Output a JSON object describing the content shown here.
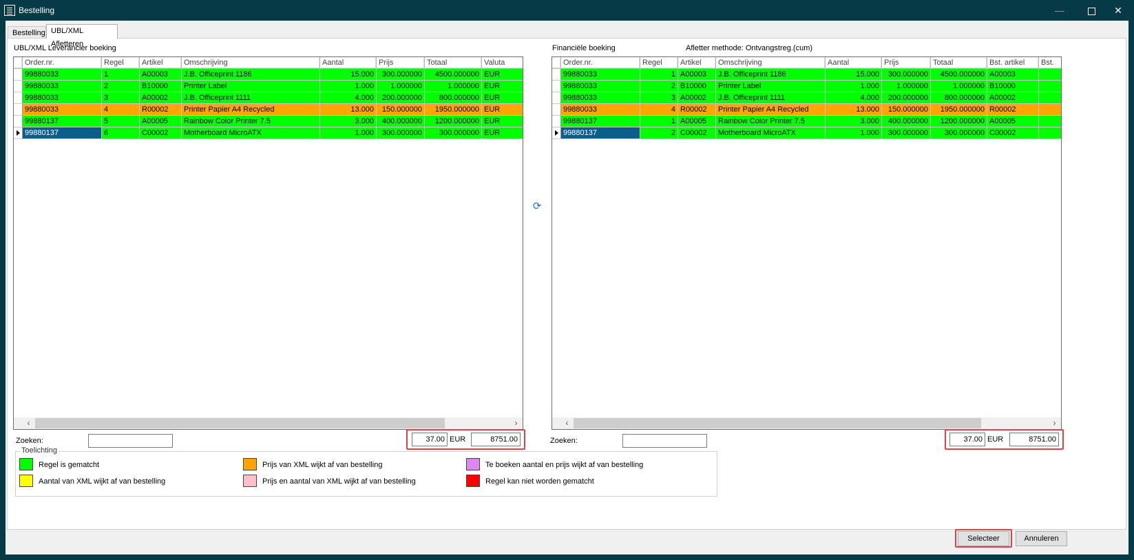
{
  "window": {
    "title": "Bestelling",
    "min_glyph": "—",
    "close_glyph": "✕"
  },
  "tabs": [
    {
      "label": "Bestelling"
    },
    {
      "label": "UBL/XML Afletteren"
    }
  ],
  "left": {
    "title": "UBL/XML Leverancier boeking",
    "columns": [
      "Order.nr.",
      "Regel",
      "Artikel",
      "Omschrijving",
      "Aantal",
      "Prijs",
      "Totaal",
      "Valuta"
    ],
    "rows": [
      [
        "99880033",
        "1",
        "A00003",
        "J.B. Officeprint 1186",
        "15.000",
        "300.000000",
        "4500.000000",
        "EUR"
      ],
      [
        "99880033",
        "2",
        "B10000",
        "Printer Label",
        "1.000",
        "1.000000",
        "1.000000",
        "EUR"
      ],
      [
        "99880033",
        "3",
        "A00002",
        "J.B. Officeprint 1111",
        "4.000",
        "200.000000",
        "800.000000",
        "EUR"
      ],
      [
        "99880033",
        "4",
        "R00002",
        "Printer Papier A4 Recycled",
        "13.000",
        "150.000000",
        "1950.000000",
        "EUR"
      ],
      [
        "99880137",
        "5",
        "A00005",
        "Rainbow Color Printer 7.5",
        "3.000",
        "400.000000",
        "1200.000000",
        "EUR"
      ],
      [
        "99880137",
        "6",
        "C00002",
        "Motherboard MicroATX",
        "1.000",
        "300.000000",
        "300.000000",
        "EUR"
      ]
    ],
    "row_status": [
      "green",
      "green",
      "green",
      "orange",
      "green",
      "green"
    ],
    "search_label": "Zoeken:",
    "search_value": "",
    "total_qty": "37.00",
    "currency": "EUR",
    "total_amount": "8751.00"
  },
  "right": {
    "title": "Financiële boeking",
    "method_label": "Afletter methode: Ontvangstreg.(cum)",
    "columns": [
      "Order.nr.",
      "Regel",
      "Artikel",
      "Omschrijving",
      "Aantal",
      "Prijs",
      "Totaal",
      "Bst. artikel",
      "Bst."
    ],
    "rows": [
      [
        "99880033",
        "1",
        "A00003",
        "J.B. Officeprint 1186",
        "15.000",
        "300.000000",
        "4500.000000",
        "A00003",
        ""
      ],
      [
        "99880033",
        "2",
        "B10000",
        "Printer Label",
        "1.000",
        "1.000000",
        "1.000000",
        "B10000",
        ""
      ],
      [
        "99880033",
        "3",
        "A00002",
        "J.B. Officeprint 1111",
        "4.000",
        "200.000000",
        "800.000000",
        "A00002",
        ""
      ],
      [
        "99880033",
        "4",
        "R00002",
        "Printer Papier A4 Recycled",
        "13.000",
        "150.000000",
        "1950.000000",
        "R00002",
        ""
      ],
      [
        "99880137",
        "1",
        "A00005",
        "Rainbow Color Printer 7.5",
        "3.000",
        "400.000000",
        "1200.000000",
        "A00005",
        ""
      ],
      [
        "99880137",
        "2",
        "C00002",
        "Motherboard MicroATX",
        "1.000",
        "300.000000",
        "300.000000",
        "C00002",
        ""
      ]
    ],
    "row_status": [
      "green",
      "green",
      "green",
      "orange",
      "green",
      "green"
    ],
    "search_label": "Zoeken:",
    "search_value": "",
    "total_qty": "37.00",
    "currency": "EUR",
    "total_amount": "8751.00"
  },
  "legend": {
    "title": "Toelichting",
    "items": [
      {
        "label": "Regel is gematcht",
        "color": "#00ff00"
      },
      {
        "label": "Prijs van XML wijkt af van bestelling",
        "color": "#ffa500"
      },
      {
        "label": "Te boeken aantal en prijs wijkt af van bestelling",
        "color": "#dd88ee"
      },
      {
        "label": "Aantal van XML wijkt af van bestelling",
        "color": "#ffff00"
      },
      {
        "label": "Prijs en aantal van XML wijkt af van bestelling",
        "color": "#ffc0cb"
      },
      {
        "label": "Regel kan niet worden gematcht",
        "color": "#ff0000"
      }
    ]
  },
  "buttons": {
    "select": "Selecteer",
    "cancel": "Annuleren"
  },
  "colors": {
    "matched": "#00ff00",
    "price_diff": "#ffa500",
    "selected": "#0d5d8a",
    "highlight": "#e04048"
  }
}
